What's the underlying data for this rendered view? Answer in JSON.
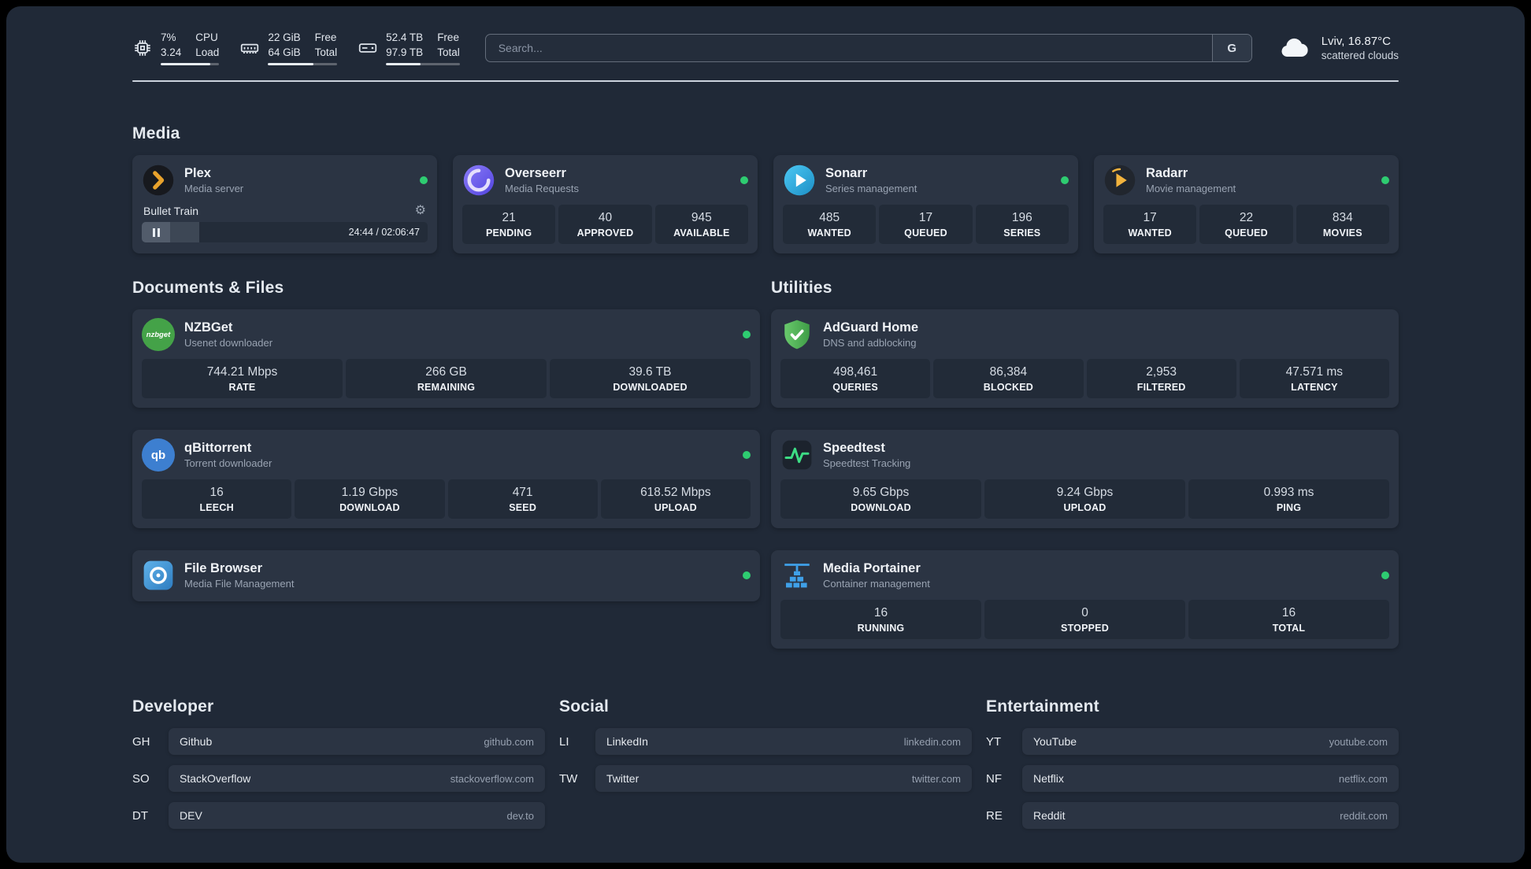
{
  "topbar": {
    "cpu": {
      "value_a": "7%",
      "value_b": "3.24",
      "label_a": "CPU",
      "label_b": "Load",
      "bar_pct": 85
    },
    "memory": {
      "value_a": "22 GiB",
      "value_b": "64 GiB",
      "label_a": "Free",
      "label_b": "Total",
      "bar_pct": 66
    },
    "disk": {
      "value_a": "52.4 TB",
      "value_b": "97.9 TB",
      "label_a": "Free",
      "label_b": "Total",
      "bar_pct": 47
    },
    "search": {
      "placeholder": "Search...",
      "engine_button": "G"
    },
    "weather": {
      "location": "Lviv, 16.87°C",
      "condition": "scattered clouds"
    }
  },
  "sections": {
    "media": {
      "title": "Media"
    },
    "documents": {
      "title": "Documents & Files"
    },
    "utilities": {
      "title": "Utilities"
    },
    "developer": {
      "title": "Developer"
    },
    "social": {
      "title": "Social"
    },
    "entertainment": {
      "title": "Entertainment"
    }
  },
  "services": {
    "plex": {
      "name": "Plex",
      "subtitle": "Media server",
      "now_playing": "Bullet Train",
      "time": "24:44 / 02:06:47",
      "progress_pct": 20
    },
    "overseerr": {
      "name": "Overseerr",
      "subtitle": "Media Requests",
      "stats": [
        {
          "value": "21",
          "label": "PENDING"
        },
        {
          "value": "40",
          "label": "APPROVED"
        },
        {
          "value": "945",
          "label": "AVAILABLE"
        }
      ]
    },
    "sonarr": {
      "name": "Sonarr",
      "subtitle": "Series management",
      "stats": [
        {
          "value": "485",
          "label": "WANTED"
        },
        {
          "value": "17",
          "label": "QUEUED"
        },
        {
          "value": "196",
          "label": "SERIES"
        }
      ]
    },
    "radarr": {
      "name": "Radarr",
      "subtitle": "Movie management",
      "stats": [
        {
          "value": "17",
          "label": "WANTED"
        },
        {
          "value": "22",
          "label": "QUEUED"
        },
        {
          "value": "834",
          "label": "MOVIES"
        }
      ]
    },
    "nzbget": {
      "name": "NZBGet",
      "subtitle": "Usenet downloader",
      "stats": [
        {
          "value": "744.21 Mbps",
          "label": "RATE"
        },
        {
          "value": "266 GB",
          "label": "REMAINING"
        },
        {
          "value": "39.6 TB",
          "label": "DOWNLOADED"
        }
      ]
    },
    "qbittorrent": {
      "name": "qBittorrent",
      "subtitle": "Torrent downloader",
      "stats": [
        {
          "value": "16",
          "label": "LEECH"
        },
        {
          "value": "1.19 Gbps",
          "label": "DOWNLOAD"
        },
        {
          "value": "471",
          "label": "SEED"
        },
        {
          "value": "618.52 Mbps",
          "label": "UPLOAD"
        }
      ]
    },
    "filebrowser": {
      "name": "File Browser",
      "subtitle": "Media File Management"
    },
    "adguard": {
      "name": "AdGuard Home",
      "subtitle": "DNS and adblocking",
      "stats": [
        {
          "value": "498,461",
          "label": "QUERIES"
        },
        {
          "value": "86,384",
          "label": "BLOCKED"
        },
        {
          "value": "2,953",
          "label": "FILTERED"
        },
        {
          "value": "47.571 ms",
          "label": "LATENCY"
        }
      ]
    },
    "speedtest": {
      "name": "Speedtest",
      "subtitle": "Speedtest Tracking",
      "stats": [
        {
          "value": "9.65 Gbps",
          "label": "DOWNLOAD"
        },
        {
          "value": "9.24 Gbps",
          "label": "UPLOAD"
        },
        {
          "value": "0.993 ms",
          "label": "PING"
        }
      ]
    },
    "portainer": {
      "name": "Media Portainer",
      "subtitle": "Container management",
      "stats": [
        {
          "value": "16",
          "label": "RUNNING"
        },
        {
          "value": "0",
          "label": "STOPPED"
        },
        {
          "value": "16",
          "label": "TOTAL"
        }
      ]
    }
  },
  "bookmarks": {
    "developer": [
      {
        "abbr": "GH",
        "name": "Github",
        "domain": "github.com"
      },
      {
        "abbr": "SO",
        "name": "StackOverflow",
        "domain": "stackoverflow.com"
      },
      {
        "abbr": "DT",
        "name": "DEV",
        "domain": "dev.to"
      }
    ],
    "social": [
      {
        "abbr": "LI",
        "name": "LinkedIn",
        "domain": "linkedin.com"
      },
      {
        "abbr": "TW",
        "name": "Twitter",
        "domain": "twitter.com"
      }
    ],
    "entertainment": [
      {
        "abbr": "YT",
        "name": "YouTube",
        "domain": "youtube.com"
      },
      {
        "abbr": "NF",
        "name": "Netflix",
        "domain": "netflix.com"
      },
      {
        "abbr": "RE",
        "name": "Reddit",
        "domain": "reddit.com"
      }
    ]
  },
  "icons": {
    "nzbget_text": "nzbget",
    "qbittorrent_text": "qb",
    "gear": "⚙"
  },
  "colors": {
    "status_online": "#2ecc71",
    "accent_amber": "#e8a22c"
  }
}
